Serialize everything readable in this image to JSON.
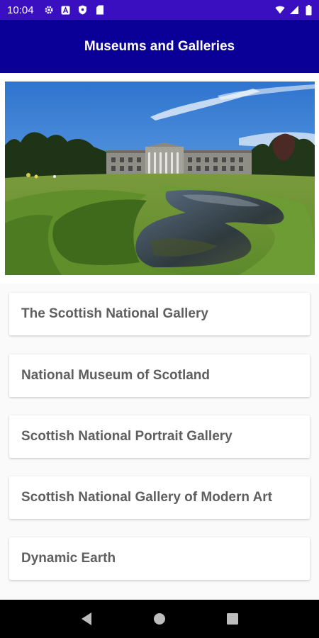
{
  "status_bar": {
    "time": "10:04",
    "left_icons": [
      "gear-icon",
      "a-badge-icon",
      "shield-icon",
      "sd-card-icon"
    ],
    "right_icons": [
      "wifi-icon",
      "signal-icon",
      "battery-icon"
    ]
  },
  "app_bar": {
    "title": "Museums and Galleries",
    "color": "#0a0097"
  },
  "hero": {
    "image_icon": "museum-landscape-photo"
  },
  "list": {
    "items": [
      {
        "label": "The Scottish National Gallery"
      },
      {
        "label": "National Museum of Scotland"
      },
      {
        "label": "Scottish National Portrait Gallery"
      },
      {
        "label": "Scottish National Gallery of Modern Art"
      },
      {
        "label": "Dynamic Earth"
      }
    ]
  },
  "nav_bar": {
    "buttons": [
      "back-icon",
      "home-icon",
      "recents-icon"
    ]
  },
  "colors": {
    "status_bar": "#3a0fc0",
    "item_text": "#5f5f5f"
  }
}
